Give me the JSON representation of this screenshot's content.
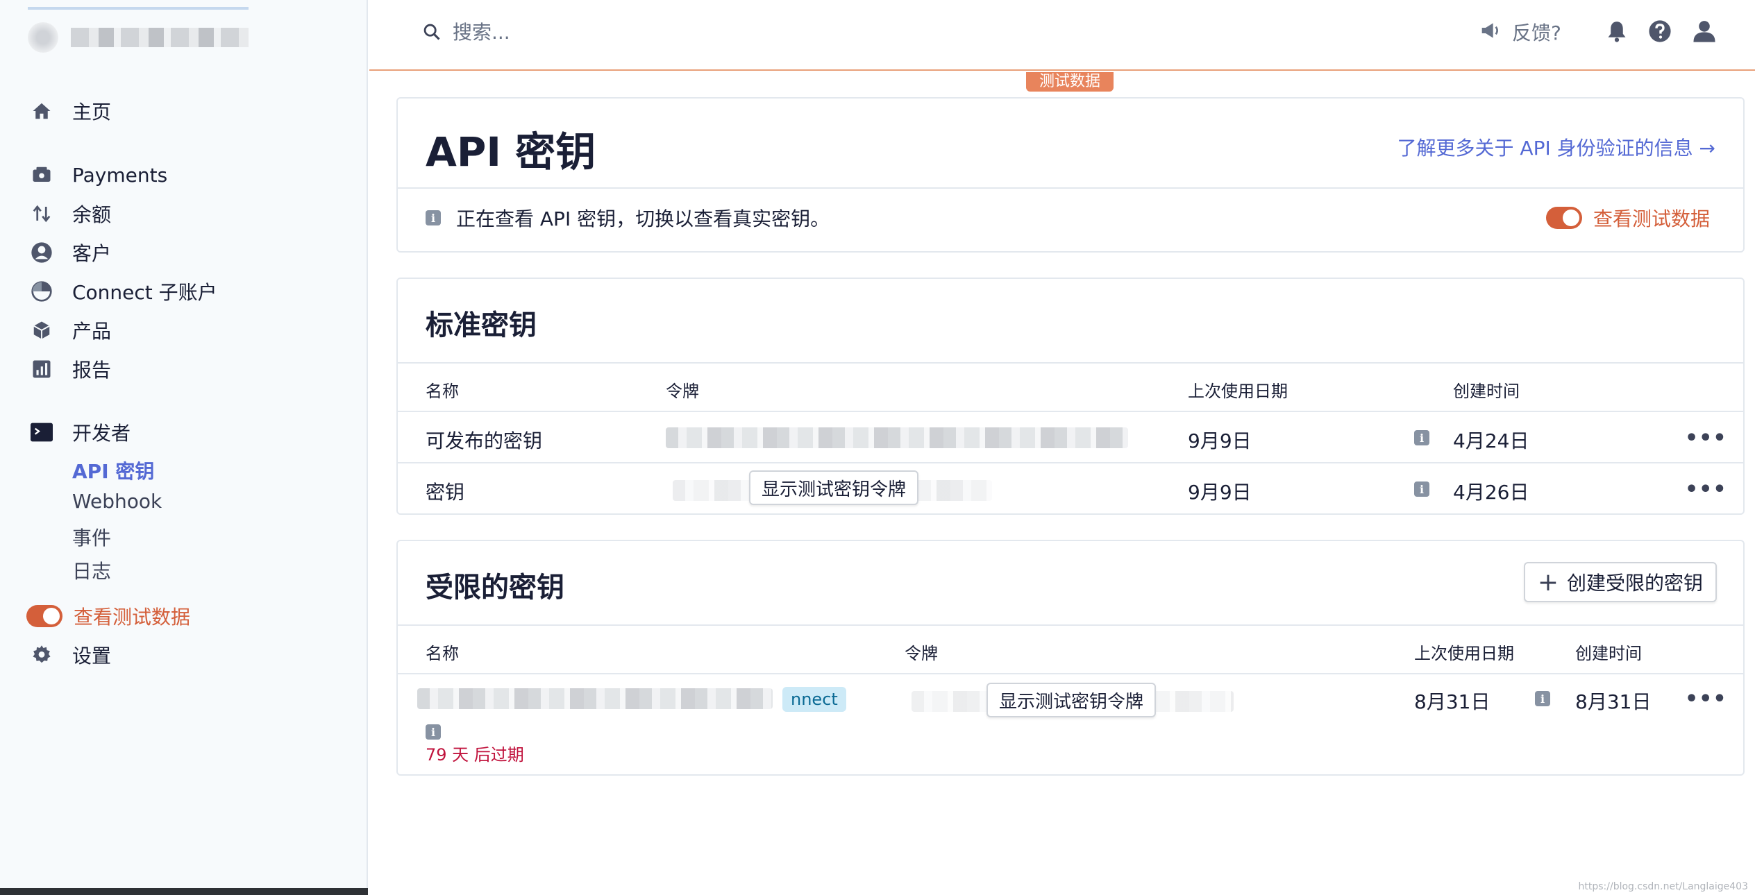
{
  "sidebar": {
    "items": [
      {
        "label": "主页",
        "icon": "home-icon"
      },
      {
        "label": "Payments",
        "icon": "payments-icon"
      },
      {
        "label": "余额",
        "icon": "balance-arrows-icon"
      },
      {
        "label": "客户",
        "icon": "customer-icon"
      },
      {
        "label": "Connect 子账户",
        "icon": "connect-icon"
      },
      {
        "label": "产品",
        "icon": "product-box-icon"
      },
      {
        "label": "报告",
        "icon": "report-chart-icon"
      },
      {
        "label": "开发者",
        "icon": "terminal-icon"
      }
    ],
    "developer_sub": [
      "API 密钥",
      "Webhook",
      "事件",
      "日志"
    ],
    "test_toggle_label": "查看测试数据",
    "settings_label": "设置"
  },
  "header": {
    "search_placeholder": "搜索...",
    "feedback_label": "反馈?",
    "test_badge": "测试数据"
  },
  "api_card": {
    "title": "API 密钥",
    "learn_more": "了解更多关于 API 身份验证的信息 →",
    "info_text": "正在查看 API 密钥，切换以查看真实密钥。",
    "view_test_label": "查看测试数据"
  },
  "standard_keys": {
    "title": "标准密钥",
    "columns": [
      "名称",
      "令牌",
      "上次使用日期",
      "创建时间"
    ],
    "rows": [
      {
        "name": "可发布的密钥",
        "last_used": "9月9日",
        "created": "4月24日"
      },
      {
        "name": "密钥",
        "reveal_label": "显示测试密钥令牌",
        "last_used": "9月9日",
        "created": "4月26日"
      }
    ]
  },
  "restricted_keys": {
    "title": "受限的密钥",
    "create_label": "创建受限的密钥",
    "columns": [
      "名称",
      "令牌",
      "上次使用日期",
      "创建时间"
    ],
    "rows": [
      {
        "badge": "nnect",
        "reveal_label": "显示测试密钥令牌",
        "last_used": "8月31日",
        "created": "8月31日",
        "expire": "79 天 后过期"
      }
    ]
  },
  "more_label": "•••",
  "info_glyph": "i",
  "watermark": "https://blog.csdn.net/Langlaige403",
  "colors": {
    "accent": "#5469d4",
    "test": "#d45f3a",
    "badge": "#e8845c",
    "expire": "#c0123c"
  }
}
